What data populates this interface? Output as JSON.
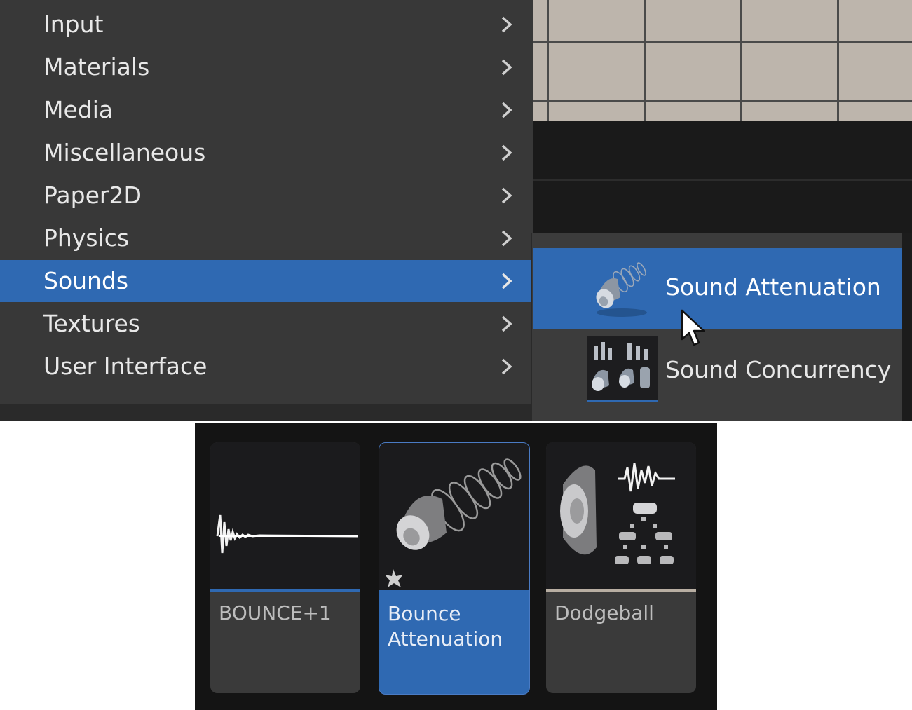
{
  "main_menu": {
    "items": [
      {
        "label": "Input",
        "active": false
      },
      {
        "label": "Materials",
        "active": false
      },
      {
        "label": "Media",
        "active": false
      },
      {
        "label": "Miscellaneous",
        "active": false
      },
      {
        "label": "Paper2D",
        "active": false
      },
      {
        "label": "Physics",
        "active": false
      },
      {
        "label": "Sounds",
        "active": true
      },
      {
        "label": "Textures",
        "active": false
      },
      {
        "label": "User Interface",
        "active": false
      }
    ]
  },
  "sub_menu": {
    "items": [
      {
        "label": "Sound Attenuation",
        "icon": "sound-attenuation-icon",
        "active": true
      },
      {
        "label": "Sound Concurrency",
        "icon": "sound-concurrency-icon",
        "active": false
      }
    ]
  },
  "content_browser": {
    "assets": [
      {
        "name": "BOUNCE+1",
        "icon": "sound-wave-icon",
        "selected": false,
        "bar_color": "#2f69b2"
      },
      {
        "name": "Bounce\nAttenuation",
        "icon": "sound-attenuation-icon",
        "selected": true,
        "bar_color": "#2f69b2"
      },
      {
        "name": "Dodgeball",
        "icon": "sound-cue-icon",
        "selected": false,
        "bar_color": "#b8aea2"
      }
    ]
  },
  "colors": {
    "highlight": "#2f69b2",
    "menu_background": "#383838",
    "panel_background": "#141414"
  }
}
